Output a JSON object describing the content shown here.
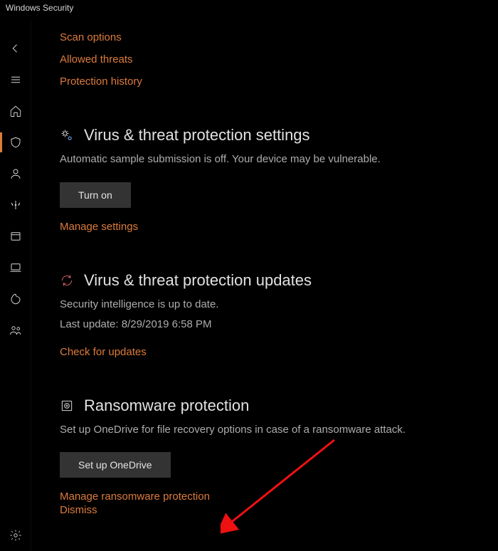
{
  "window": {
    "title": "Windows Security"
  },
  "links": {
    "scan_options": "Scan options",
    "allowed_threats": "Allowed threats",
    "protection_history": "Protection history"
  },
  "settings": {
    "title": "Virus & threat protection settings",
    "desc": "Automatic sample submission is off. Your device may be vulnerable.",
    "button": "Turn on",
    "manage_link": "Manage settings"
  },
  "updates": {
    "title": "Virus & threat protection updates",
    "desc1": "Security intelligence is up to date.",
    "desc2": "Last update: 8/29/2019 6:58 PM",
    "check_link": "Check for updates"
  },
  "ransomware": {
    "title": "Ransomware protection",
    "desc": "Set up OneDrive for file recovery options in case of a ransomware attack.",
    "button": "Set up OneDrive",
    "manage_link": "Manage ransomware protection",
    "dismiss_link": "Dismiss"
  }
}
